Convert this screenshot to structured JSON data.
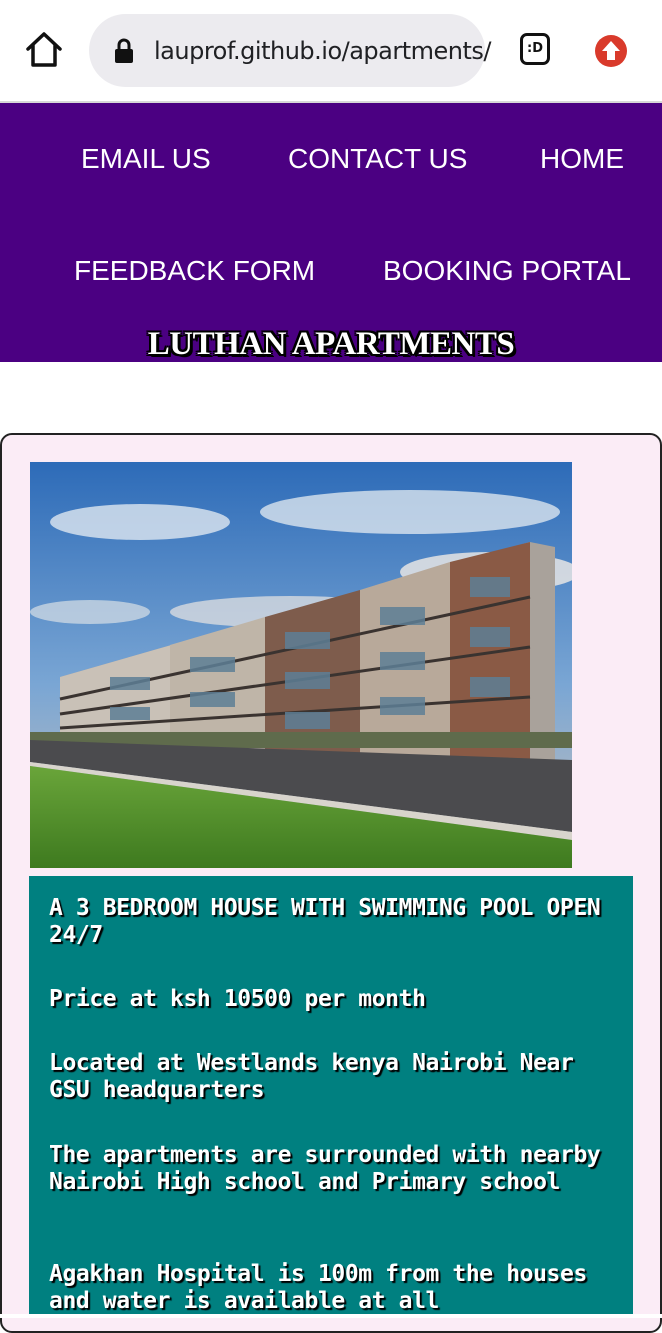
{
  "browser": {
    "url": "lauprof.github.io/apartments/",
    "tabs_label": ":D",
    "icons": [
      "home-icon",
      "lock-icon",
      "tab-switcher-icon",
      "update-icon"
    ]
  },
  "nav": {
    "email_us": "EMAIL US",
    "contact_us": "CONTACT US",
    "home": "HOME",
    "feedback_form": "FEEDBACK FORM",
    "booking_portal": "BOOKING PORTAL"
  },
  "header": {
    "title": "LUTHAN APARTMENTS"
  },
  "listing": {
    "headline": "A 3 BEDROOM HOUSE WITH SWIMMING POOL OPEN 24/7",
    "price": "Price at ksh 10500 per month",
    "location": "Located at Westlands kenya Nairobi Near GSU headquarters",
    "surroundings": "The apartments are surrounded with nearby Nairobi High school and Primary school",
    "amenities": "Agakhan Hospital is 100m from the houses and water is available at all"
  },
  "colors": {
    "header_bg": "#4b0082",
    "card_bg": "#fbecf6",
    "panel_bg": "#008080",
    "update_icon": "#d93a2b"
  }
}
